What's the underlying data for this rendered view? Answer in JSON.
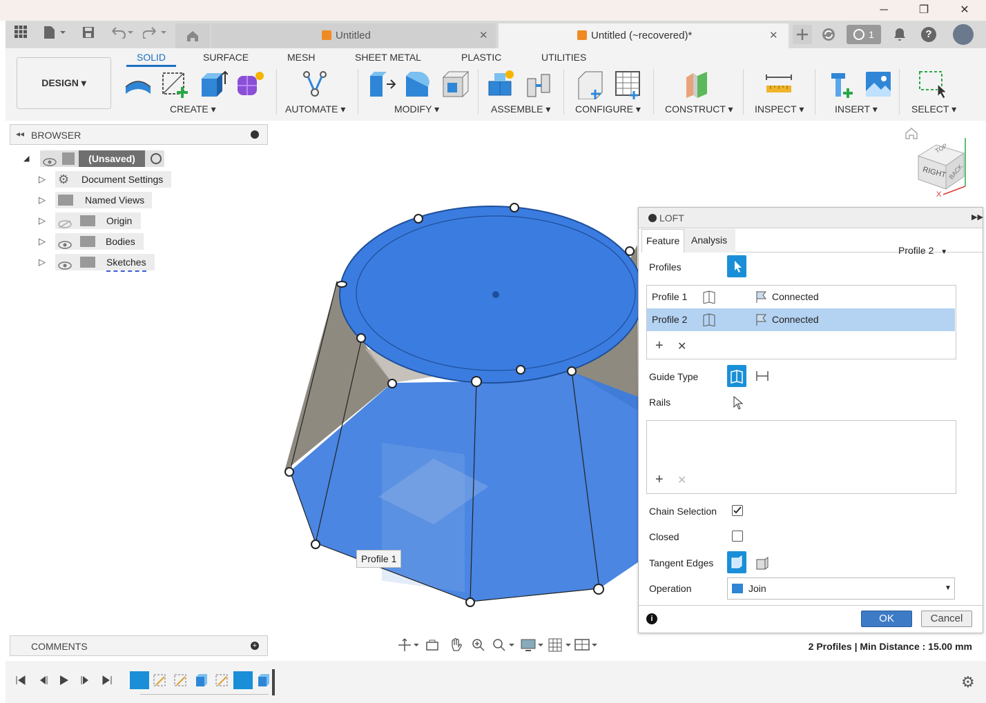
{
  "window": {
    "minimize": "─",
    "restore": "❐",
    "close": "✕"
  },
  "tabs": [
    {
      "label": "Untitled",
      "close": "✕"
    },
    {
      "label": "Untitled (~recovered)*",
      "close": "✕"
    }
  ],
  "toolbar_right": {
    "jobs_count": "1",
    "help": "?"
  },
  "ribbon": {
    "tabs": [
      "SOLID",
      "SURFACE",
      "MESH",
      "SHEET METAL",
      "PLASTIC",
      "UTILITIES"
    ],
    "workspace": "DESIGN ▾",
    "groups": [
      "CREATE ▾",
      "AUTOMATE ▾",
      "MODIFY ▾",
      "ASSEMBLE ▾",
      "CONFIGURE ▾",
      "CONSTRUCT ▾",
      "INSPECT ▾",
      "INSERT ▾",
      "SELECT ▾"
    ]
  },
  "browser": {
    "title": "BROWSER",
    "root": "(Unsaved)",
    "items": [
      "Document Settings",
      "Named Views",
      "Origin",
      "Bodies",
      "Sketches"
    ]
  },
  "comments": {
    "title": "COMMENTS"
  },
  "viewport": {
    "profile_label": "Profile 1",
    "viewcube": {
      "top": "TOP",
      "right": "RIGHT",
      "back": "BACK"
    }
  },
  "loft": {
    "title": "LOFT",
    "tabs": [
      "Feature",
      "Analysis"
    ],
    "profile_select": "Profile 2",
    "profiles_label": "Profiles",
    "profile_rows": [
      {
        "name": "Profile 1",
        "condition": "Connected"
      },
      {
        "name": "Profile 2",
        "condition": "Connected"
      }
    ],
    "guide_type_label": "Guide Type",
    "rails_label": "Rails",
    "chain_selection_label": "Chain Selection",
    "chain_selection_checked": true,
    "closed_label": "Closed",
    "closed_checked": false,
    "tangent_edges_label": "Tangent Edges",
    "operation_label": "Operation",
    "operation_value": "Join",
    "ok": "OK",
    "cancel": "Cancel"
  },
  "status": "2 Profiles | Min Distance : 15.00 mm",
  "colors": {
    "accent": "#1a8fd8",
    "body_blue": "#3a79d6",
    "tab_blue": "#1a6fc4"
  }
}
